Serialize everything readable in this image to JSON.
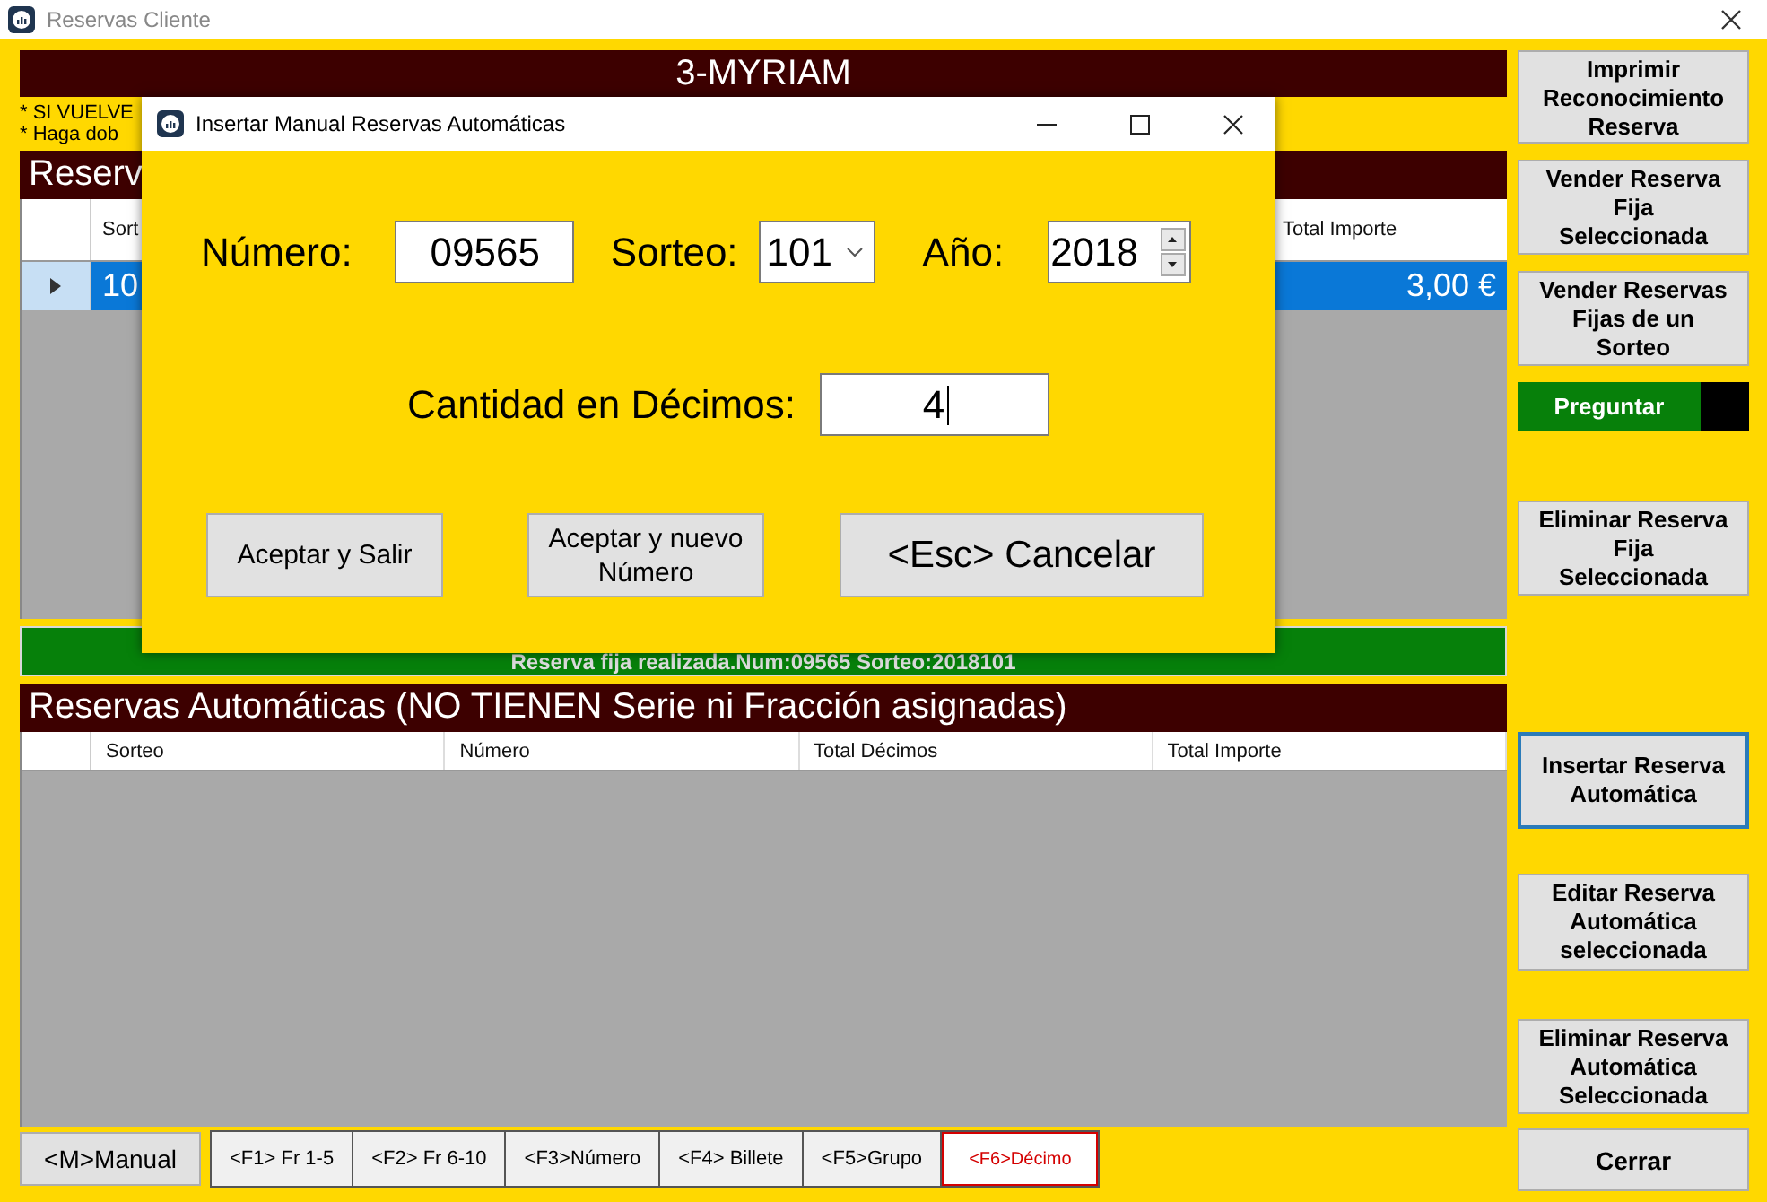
{
  "window": {
    "title": "Reservas Cliente"
  },
  "client_name": "3-MYRIAM",
  "notes": [
    "* SI VUELVE",
    "* Haga dob"
  ],
  "fixed_reservations": {
    "title": "Reserv",
    "columns": [
      "Sort",
      "Total Importe"
    ],
    "rows": [
      {
        "cells": [
          "10",
          "3,00 €"
        ],
        "selected": true
      }
    ]
  },
  "status_message": "Reserva fija realizada.Num:09565 Sorteo:2018101",
  "auto_reservations": {
    "title": "Reservas Automáticas (NO TIENEN Serie ni Fracción asignadas)",
    "columns": [
      "Sorteo",
      "Número",
      "Total Décimos",
      "Total Importe"
    ]
  },
  "manual_button": "<M>Manual",
  "filter_tabs": [
    {
      "label": "<F1> Fr 1-5",
      "selected": false
    },
    {
      "label": "<F2> Fr 6-10",
      "selected": false
    },
    {
      "label": "<F3>Número",
      "selected": false
    },
    {
      "label": "<F4> Billete",
      "selected": false
    },
    {
      "label": "<F5>Grupo",
      "selected": false
    },
    {
      "label": "<F6>Décimo",
      "selected": true
    }
  ],
  "side_buttons": [
    {
      "kind": "button",
      "label": "Imprimir\nReconocimiento\nReserva",
      "focused": false
    },
    {
      "kind": "button",
      "label": "Vender Reserva\nFija\nSeleccionada",
      "focused": false
    },
    {
      "kind": "button",
      "label": "Vender Reservas\nFijas de un\nSorteo",
      "focused": false
    },
    {
      "kind": "toggle",
      "label": "Preguntar",
      "on": true
    },
    {
      "kind": "button",
      "label": "Eliminar Reserva\nFija\nSeleccionada",
      "focused": false
    },
    {
      "kind": "button",
      "label": "Insertar Reserva\nAutomática",
      "focused": true
    },
    {
      "kind": "button",
      "label": "Editar Reserva\nAutomática\nseleccionada",
      "focused": false
    },
    {
      "kind": "button",
      "label": "Eliminar Reserva\nAutomática\nSeleccionada",
      "focused": false
    },
    {
      "kind": "button",
      "label": "Cerrar",
      "focused": false
    }
  ],
  "dialog": {
    "title": "Insertar Manual Reservas Automáticas",
    "numero_label": "Número:",
    "numero": "09565",
    "sorteo_label": "Sorteo:",
    "sorteo": "101",
    "anio_label": "Año:",
    "anio": "2018",
    "cantidad_label": "Cantidad en Décimos:",
    "cantidad": "4",
    "buttons": [
      "Aceptar y Salir",
      "Aceptar y nuevo\nNúmero",
      "<Esc> Cancelar"
    ]
  }
}
